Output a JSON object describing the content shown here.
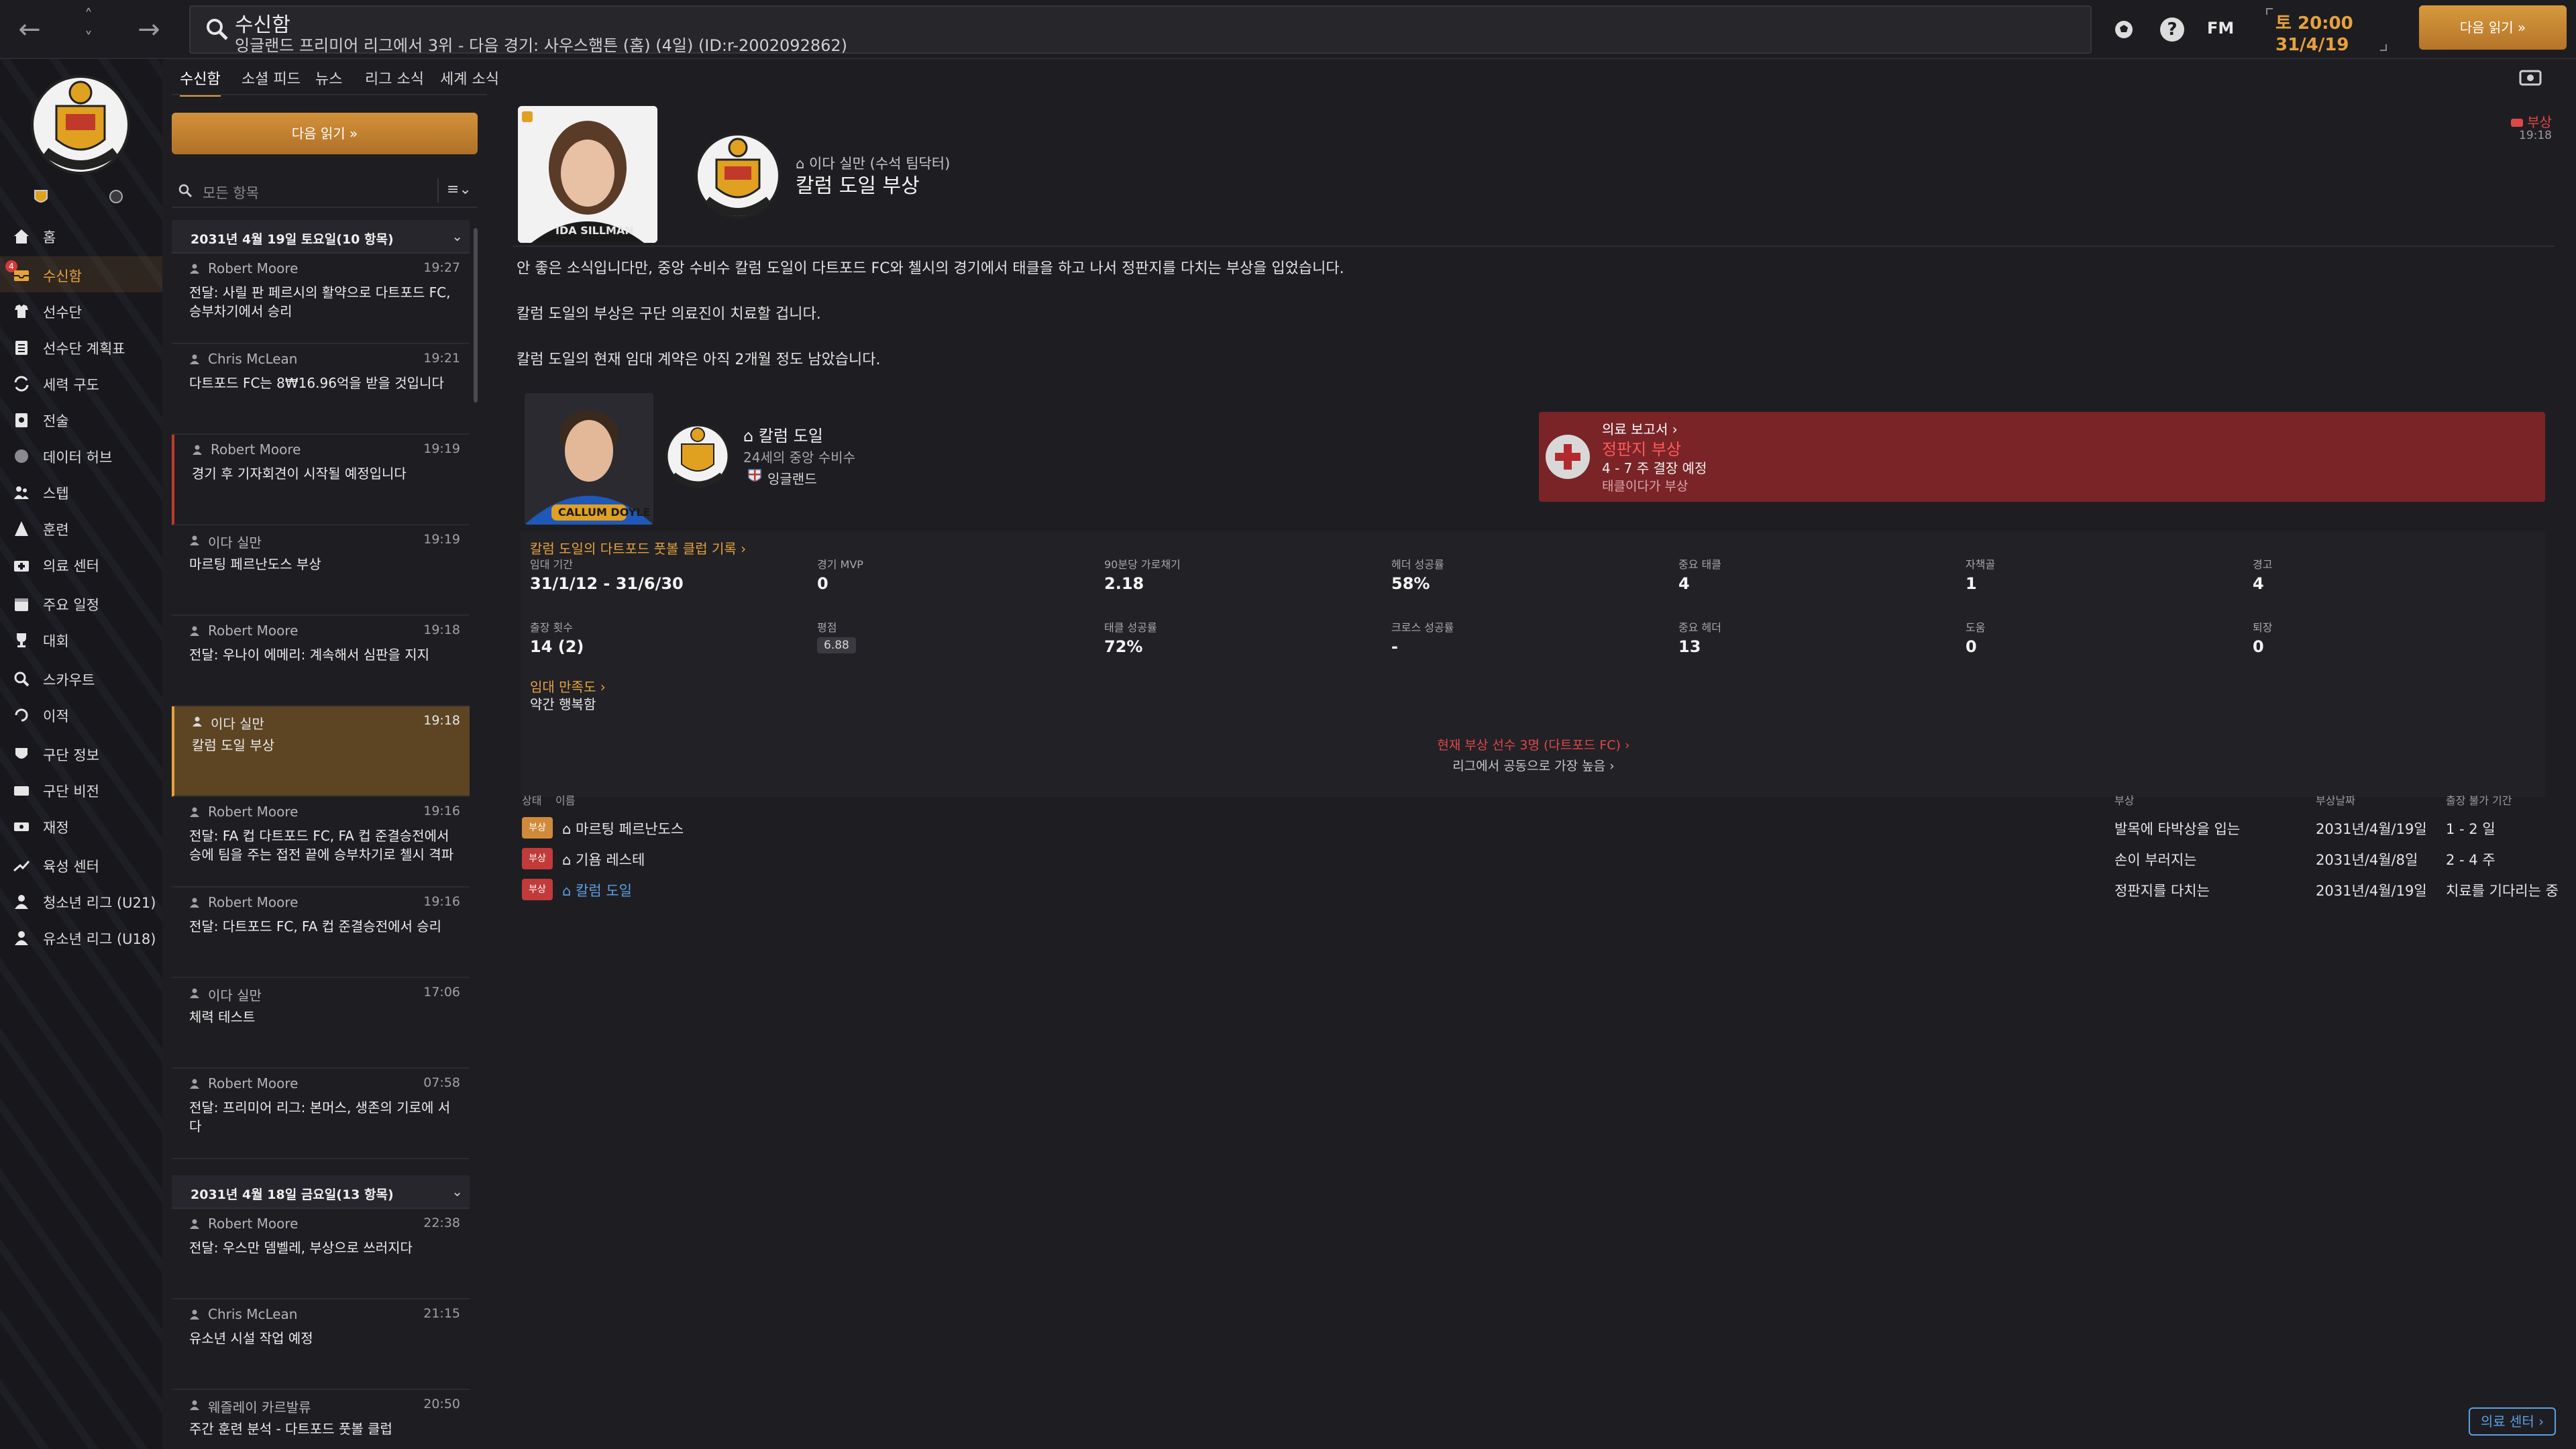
{
  "topbar": {
    "back_icon": "←",
    "forward_icon": "→",
    "up_icon": "˄",
    "down_icon": "˅",
    "title": "수신함",
    "subtitle": "잉글랜드 프리미어 리그에서 3위 - 다음 경기: 사우스햄튼 (홈) (4일) (ID:r-2002092862)",
    "help": "?",
    "fm": "FM",
    "day_time": "토 20:00",
    "date": "31/4/19",
    "continue_label": "다음 읽기 »"
  },
  "sidebar": {
    "items": [
      {
        "label": "홈",
        "icon": "home-icon"
      },
      {
        "label": "수신함",
        "icon": "inbox-icon",
        "badge": "4"
      },
      {
        "label": "선수단",
        "icon": "squad-icon"
      },
      {
        "label": "선수단 계획표",
        "icon": "planner-icon"
      },
      {
        "label": "세력 구도",
        "icon": "dynamics-icon"
      },
      {
        "label": "전술",
        "icon": "tactics-icon"
      },
      {
        "label": "데이터 허브",
        "icon": "data-hub-icon"
      },
      {
        "label": "스텝",
        "icon": "staff-icon"
      },
      {
        "label": "훈련",
        "icon": "training-icon"
      },
      {
        "label": "의료 센터",
        "icon": "medical-icon"
      },
      {
        "label": "주요 일정",
        "icon": "calendar-icon"
      },
      {
        "label": "대회",
        "icon": "trophy-icon"
      },
      {
        "label": "스카우트",
        "icon": "scouting-icon"
      },
      {
        "label": "이적",
        "icon": "transfers-icon"
      },
      {
        "label": "구단 정보",
        "icon": "club-info-icon"
      },
      {
        "label": "구단 비전",
        "icon": "vision-icon"
      },
      {
        "label": "재정",
        "icon": "finances-icon"
      },
      {
        "label": "육성 센터",
        "icon": "development-icon"
      },
      {
        "label": "청소년 리그 (U21)",
        "icon": "u21-icon"
      },
      {
        "label": "유소년 리그 (U18)",
        "icon": "u18-icon"
      }
    ]
  },
  "inbox": {
    "tabs": [
      "수신함",
      "소셜 피드",
      "뉴스",
      "리그 소식",
      "세계 소식"
    ],
    "read_next": "다음 읽기 »",
    "search_placeholder": "모든 항목",
    "groups": [
      {
        "date": "2031년 4월 19일 토요일(10 항목)",
        "messages": [
          {
            "sender": "Robert Moore",
            "time": "19:27",
            "subject": "전달: 사릴 판 페르시의 활약으로 다트포드 FC, 승부차기에서 승리"
          },
          {
            "sender": "Chris McLean",
            "time": "19:21",
            "subject": "다트포드 FC는 8₩16.96억을 받을 것입니다"
          },
          {
            "sender": "Robert Moore",
            "time": "19:19",
            "subject": "경기 후 기자회견이 시작될 예정입니다"
          },
          {
            "sender": "이다 실만",
            "time": "19:19",
            "subject": "마르팅 페르난도스 부상"
          },
          {
            "sender": "Robert Moore",
            "time": "19:18",
            "subject": "전달: 우나이 에메리: 계속해서 심판을 지지"
          },
          {
            "sender": "이다 실만",
            "time": "19:18",
            "subject": "칼럼 도일 부상"
          },
          {
            "sender": "Robert Moore",
            "time": "19:16",
            "subject": "전달: FA 컵 다트포드 FC, FA 컵 준결승전에서 승에 팀을 주는 접전 끝에 승부차기로 첼시 격파"
          },
          {
            "sender": "Robert Moore",
            "time": "19:16",
            "subject": "전달: 다트포드 FC, FA 컵 준결승전에서 승리"
          },
          {
            "sender": "이다 실만",
            "time": "17:06",
            "subject": "체력 테스트"
          },
          {
            "sender": "Robert Moore",
            "time": "07:58",
            "subject": "전달: 프리미어 리그: 본머스, 생존의 기로에 서다"
          }
        ]
      },
      {
        "date": "2031년 4월 18일 금요일(13 항목)",
        "messages": [
          {
            "sender": "Robert Moore",
            "time": "22:38",
            "subject": "전달: 우스만 뎀벨레, 부상으로 쓰러지다"
          },
          {
            "sender": "Chris McLean",
            "time": "21:15",
            "subject": "유소년 시설 작업 예정"
          },
          {
            "sender": "웨즐레이 카르발류",
            "time": "20:50",
            "subject": "주간 훈련 분석 - 다트포드 풋볼 클럽"
          }
        ]
      }
    ]
  },
  "message": {
    "face_caption": "IDA SILLMAN",
    "sender": "이다 실만 (수석 팀닥터)",
    "subject": "칼럼 도일 부상",
    "tag": "부상",
    "time": "19:18",
    "paragraphs": [
      "안 좋은 소식입니다만, 중앙 수비수 칼럼 도일이 다트포드 FC와 첼시의 경기에서 태클을 하고 나서 정판지를 다치는 부상을 입었습니다.",
      "칼럼 도일의 부상은 구단 의료진이 치료할 겁니다.",
      "칼럼 도일의 현재 임대 계약은 아직 2개월 정도 남았습니다."
    ],
    "player": {
      "name": "칼럼 도일",
      "age_position": "24세의 중앙 수비수",
      "nation": "잉글랜드",
      "shirt_name": "CALLUM DOYLE"
    },
    "medical": {
      "report_link": "의료 보고서 ›",
      "injury": "정판지 부상",
      "duration": "4 - 7 주 결장 예정",
      "cause": "태클이다가 부상"
    },
    "stats_link": "칼럼 도일의 다트포드 풋볼 클럽 기록 ›",
    "stats": [
      {
        "label": "임대 기간",
        "value": "31/1/12 - 31/6/30"
      },
      {
        "label": "경기 MVP",
        "value": "0"
      },
      {
        "label": "90분당 가로채기",
        "value": "2.18"
      },
      {
        "label": "헤더 성공률",
        "value": "58%"
      },
      {
        "label": "중요 태클",
        "value": "4"
      },
      {
        "label": "자책골",
        "value": "1"
      },
      {
        "label": "경고",
        "value": "4"
      },
      {
        "label": "출장 횟수",
        "value": "14 (2)"
      },
      {
        "label": "평점",
        "value": "6.88"
      },
      {
        "label": "태클 성공률",
        "value": "72%"
      },
      {
        "label": "크로스 성공률",
        "value": "-"
      },
      {
        "label": "중요 헤더",
        "value": "13"
      },
      {
        "label": "도움",
        "value": "0"
      },
      {
        "label": "퇴장",
        "value": "0"
      }
    ],
    "loan_link": "임대 만족도 ›",
    "loan_value": "약간 행복함",
    "injury_summary": "현재 부상 선수 3명 (다트포드 FC) ›",
    "injury_summary_sub": "리그에서 공동으로 가장 높음 ›",
    "injury_table": {
      "headers": [
        "상태",
        "이름",
        "부상",
        "부상날짜",
        "출장 불가 기간"
      ],
      "rows": [
        {
          "tag": "부상",
          "tag_color": "orange",
          "name": "마르팅 페르난도스",
          "injury": "발목에 타박상을 입는",
          "date": "2031년/4월/19일",
          "duration": "1 - 2 일"
        },
        {
          "tag": "부상",
          "tag_color": "red",
          "name": "기욤 레스테",
          "injury": "손이 부러지는",
          "date": "2031년/4월/8일",
          "duration": "2 - 4 주"
        },
        {
          "tag": "부상",
          "tag_color": "red",
          "name": "칼럼 도일",
          "injury": "정판지를 다치는",
          "date": "2031년/4월/19일",
          "duration": "치료를 기다리는 중"
        }
      ]
    },
    "medical_centre_btn": "의료 센터 ›"
  },
  "colors": {
    "accent": "#e6a23c",
    "injury_red": "#e04848",
    "link_blue": "#5aa0e6",
    "panel_red": "#7a2428"
  }
}
